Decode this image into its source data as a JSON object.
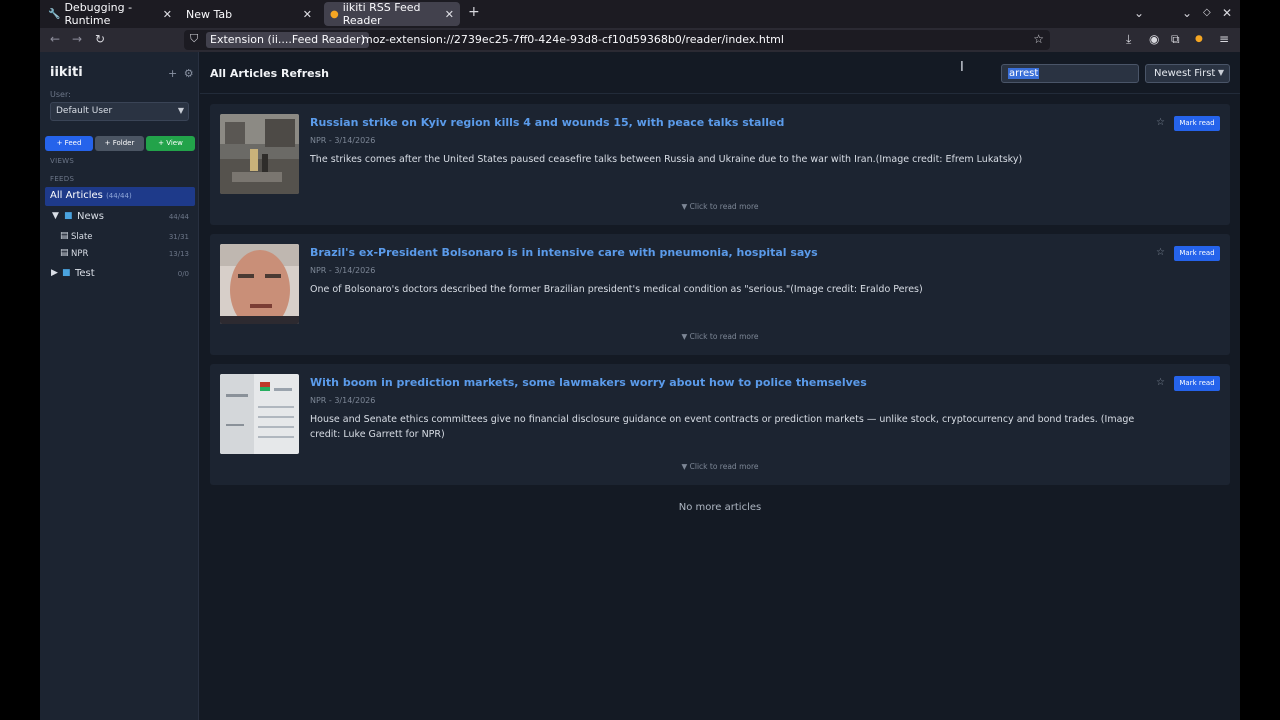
{
  "browser": {
    "tabs": [
      {
        "label": "Debugging - Runtime",
        "icon": "wrench-icon"
      },
      {
        "label": "New Tab"
      },
      {
        "label": "iikiti RSS Feed Reader",
        "active": true
      }
    ],
    "extension_chip": "Extension (ii....Feed Reader)",
    "url": "moz-extension://2739ec25-7ff0-424e-93d8-cf10d59368b0/reader/index.html"
  },
  "sidebar": {
    "brand": "iikiti",
    "user_label": "User:",
    "user_value": "Default User",
    "buttons": {
      "feed": "+ Feed",
      "folder": "+ Folder",
      "view": "+ View"
    },
    "views_label": "VIEWS",
    "feeds_label": "FEEDS",
    "all_articles": {
      "label": "All Articles",
      "count": "(44/44)"
    },
    "tree": [
      {
        "name": "News",
        "count": "44/44",
        "expanded": true
      },
      {
        "name": "Slate",
        "count": "31/31"
      },
      {
        "name": "NPR",
        "count": "13/13"
      },
      {
        "name": "Test",
        "count": "0/0",
        "expanded": false
      }
    ]
  },
  "main": {
    "title": "All Articles Refresh",
    "search_value": "arrest",
    "sort_value": "Newest First",
    "articles": [
      {
        "title": "Russian strike on Kyiv region kills 4 and wounds 15, with peace talks stalled",
        "meta": "NPR - 3/14/2026",
        "description": "The strikes comes after the United States paused ceasefire talks between Russia and Ukraine due to the war with Iran.(Image credit: Efrem Lukatsky)",
        "mark_label": "Mark read",
        "read_more": "▼ Click to read more"
      },
      {
        "title": "Brazil's ex-President Bolsonaro is in intensive care with pneumonia, hospital says",
        "meta": "NPR - 3/14/2026",
        "description": "One of Bolsonaro's doctors described the former Brazilian president's medical condition as \"serious.\"(Image credit: Eraldo Peres)",
        "mark_label": "Mark read",
        "read_more": "▼ Click to read more"
      },
      {
        "title": "With boom in prediction markets, some lawmakers worry about how to police themselves",
        "meta": "NPR - 3/14/2026",
        "description": "House and Senate ethics committees give no financial disclosure guidance on event contracts or prediction markets — unlike stock, cryptocurrency and bond trades. (Image credit: Luke Garrett for NPR)",
        "mark_label": "Mark read",
        "read_more": "▼ Click to read more"
      }
    ],
    "no_more": "No more articles"
  },
  "colors": {
    "accent": "#2563eb",
    "title_link": "#5b9bea",
    "selected_nav": "#1e3a8a",
    "view_button": "#22a34a"
  }
}
